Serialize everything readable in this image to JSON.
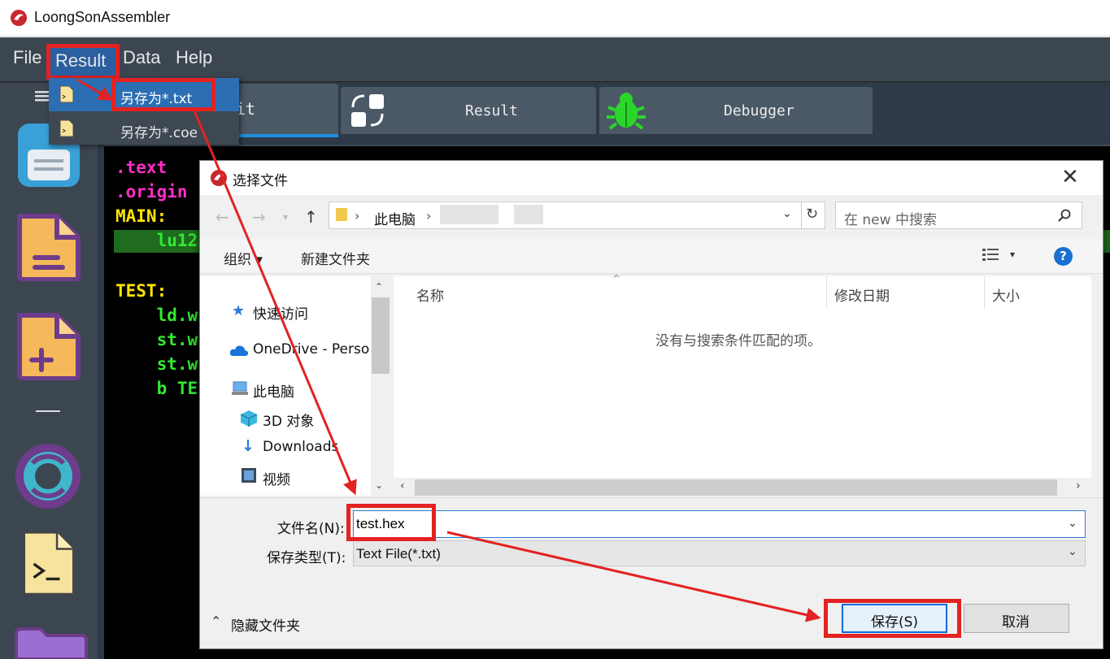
{
  "app": {
    "title": "LoongSonAssembler"
  },
  "menu": {
    "file": "File",
    "result": "Result",
    "data": "Data",
    "help": "Help"
  },
  "tabs": {
    "edit": "Edit",
    "edit_visible": "it",
    "result": "Result",
    "debugger": "Debugger"
  },
  "dropdown": {
    "items": [
      {
        "label": "另存为*.txt"
      },
      {
        "label": "另存为*.coe"
      }
    ]
  },
  "editor": {
    "lines": [
      {
        "text": ".text",
        "color": "#ff2ec6"
      },
      {
        "text": ".origin",
        "color": "#ff2ec6"
      },
      {
        "text": "MAIN:",
        "color": "#ffe500"
      },
      {
        "text": "    lu12",
        "color": "#33e933"
      },
      {
        "text": "",
        "color": "#ffffff"
      },
      {
        "text": "TEST:",
        "color": "#ffe500"
      },
      {
        "text": "    ld.w",
        "color": "#33e933"
      },
      {
        "text": "    st.w",
        "color": "#33e933"
      },
      {
        "text": "    st.w",
        "color": "#33e933"
      },
      {
        "text": "    b TE",
        "color": "#33e933"
      }
    ]
  },
  "dialog": {
    "title": "选择文件",
    "address": {
      "path": "此电脑"
    },
    "search_placeholder": "在 new 中搜索",
    "toolbar": {
      "organize": "组织 ▾",
      "new_folder": "新建文件夹"
    },
    "nav": [
      {
        "label": "快速访问"
      },
      {
        "label": "OneDrive - Perso"
      },
      {
        "label": "此电脑"
      },
      {
        "label": "3D 对象"
      },
      {
        "label": "Downloads"
      },
      {
        "label": "视频"
      }
    ],
    "columns": [
      "名称",
      "修改日期",
      "大小"
    ],
    "empty_message": "没有与搜索条件匹配的项。",
    "file_name_label": "文件名(N):",
    "file_name_value": "test.hex",
    "file_type_label": "保存类型(T):",
    "file_type_value": "Text File(*.txt)",
    "hide_folders": "隐藏文件夹",
    "save": "保存(S)",
    "cancel": "取消"
  },
  "colors": {
    "accent_red": "#e32222",
    "menu_bg": "#3c4651",
    "selected_blue": "#2c6eb3"
  }
}
